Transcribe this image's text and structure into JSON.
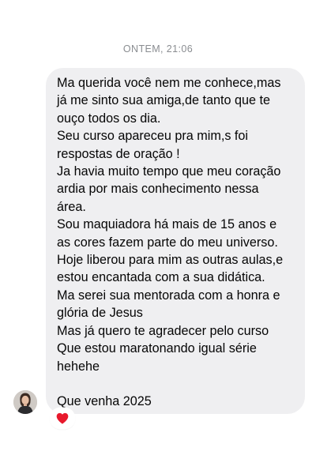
{
  "conversation": {
    "timestamp": "ONTEM, 21:06",
    "message": {
      "lines": [
        "Ma querida você nem me conhece,mas",
        "já me sinto sua amiga,de tanto que te",
        "ouço todos os dia.",
        "Seu curso apareceu pra mim,s foi",
        "respostas de oração !",
        "Ja havia muito tempo que meu coração",
        "ardia por mais conhecimento nessa",
        "área.",
        "Sou maquiadora há mais de 15 anos e",
        "as cores fazem parte do meu universo.",
        "Hoje liberou para mim as outras aulas,e",
        "estou encantada com a sua didática.",
        "Ma serei sua mentorada com a honra e",
        "glória de Jesus",
        "Mas já quero te agradecer pelo curso",
        "Que estou maratonando igual série",
        "hehehe",
        "Que venha 2025"
      ],
      "bubble_color": "#efeff1",
      "text_color": "#050505"
    },
    "sender_avatar": {
      "icon": "user-avatar-icon"
    },
    "reaction": {
      "icon": "red-heart-icon",
      "color": "#e8192c"
    }
  }
}
